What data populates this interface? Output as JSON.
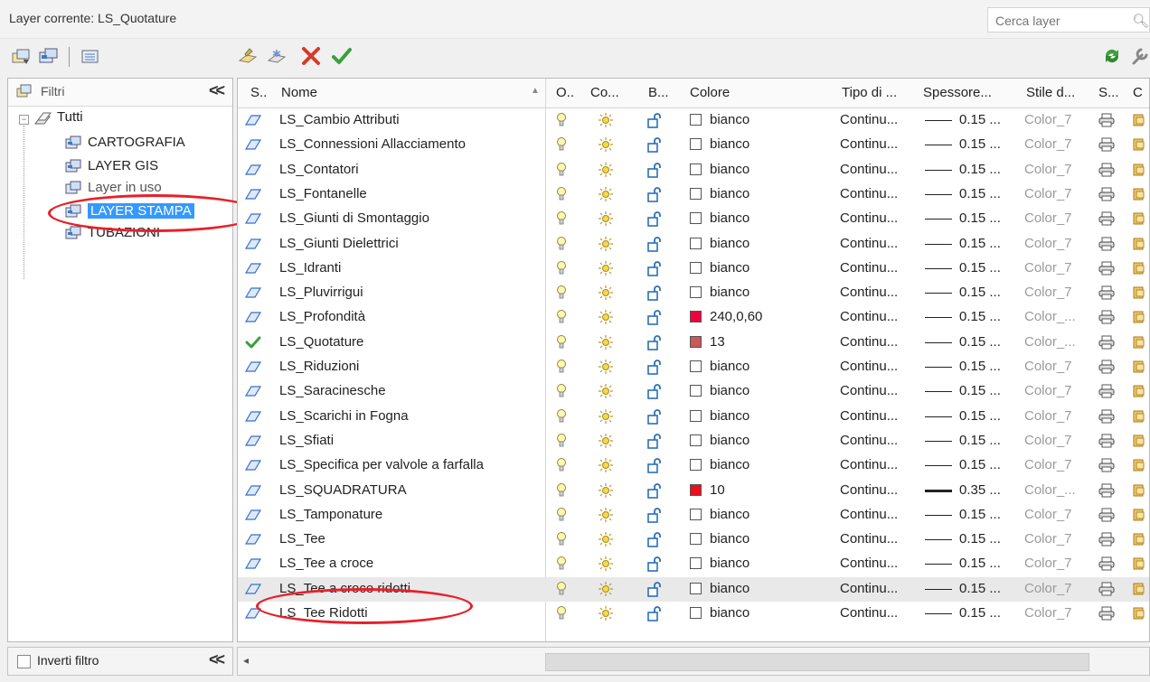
{
  "header": {
    "current_layer": "Layer corrente: LS_Quotature",
    "search_placeholder": "Cerca layer",
    "search_icon": "search-icon"
  },
  "filters": {
    "title": "Filtri",
    "collapse_label": "<<",
    "tree": {
      "root": "Tutti",
      "children": [
        "CARTOGRAFIA",
        "LAYER GIS",
        "Layer in uso",
        "LAYER STAMPA",
        "TUBAZIONI"
      ],
      "selected": "LAYER STAMPA"
    },
    "invert_label": "Inverti filtro",
    "invert_collapse_label": "<<"
  },
  "columns": [
    "S..",
    "Nome",
    "O..",
    "Co...",
    "B...",
    "Colore",
    "Tipo di ...",
    "Spessore...",
    "Stile d...",
    "S...",
    "C"
  ],
  "layers": [
    {
      "name": "LS_Cambio Attributi",
      "color": "bianco",
      "swatch": "#ffffff",
      "linetype": "Continu...",
      "weight": "0.15 ...",
      "style": "Color_7",
      "current": false
    },
    {
      "name": "LS_Connessioni Allacciamento",
      "color": "bianco",
      "swatch": "#ffffff",
      "linetype": "Continu...",
      "weight": "0.15 ...",
      "style": "Color_7",
      "current": false
    },
    {
      "name": "LS_Contatori",
      "color": "bianco",
      "swatch": "#ffffff",
      "linetype": "Continu...",
      "weight": "0.15 ...",
      "style": "Color_7",
      "current": false
    },
    {
      "name": "LS_Fontanelle",
      "color": "bianco",
      "swatch": "#ffffff",
      "linetype": "Continu...",
      "weight": "0.15 ...",
      "style": "Color_7",
      "current": false
    },
    {
      "name": "LS_Giunti di Smontaggio",
      "color": "bianco",
      "swatch": "#ffffff",
      "linetype": "Continu...",
      "weight": "0.15 ...",
      "style": "Color_7",
      "current": false
    },
    {
      "name": "LS_Giunti Dielettrici",
      "color": "bianco",
      "swatch": "#ffffff",
      "linetype": "Continu...",
      "weight": "0.15 ...",
      "style": "Color_7",
      "current": false
    },
    {
      "name": "LS_Idranti",
      "color": "bianco",
      "swatch": "#ffffff",
      "linetype": "Continu...",
      "weight": "0.15 ...",
      "style": "Color_7",
      "current": false
    },
    {
      "name": "LS_Pluvirrigui",
      "color": "bianco",
      "swatch": "#ffffff",
      "linetype": "Continu...",
      "weight": "0.15 ...",
      "style": "Color_7",
      "current": false
    },
    {
      "name": "LS_Profondità",
      "color": "240,0,60",
      "swatch": "#f0003c",
      "linetype": "Continu...",
      "weight": "0.15 ...",
      "style": "Color_...",
      "current": false
    },
    {
      "name": "LS_Quotature",
      "color": "13",
      "swatch": "#c85a5a",
      "linetype": "Continu...",
      "weight": "0.15 ...",
      "style": "Color_...",
      "current": true
    },
    {
      "name": "LS_Riduzioni",
      "color": "bianco",
      "swatch": "#ffffff",
      "linetype": "Continu...",
      "weight": "0.15 ...",
      "style": "Color_7",
      "current": false
    },
    {
      "name": "LS_Saracinesche",
      "color": "bianco",
      "swatch": "#ffffff",
      "linetype": "Continu...",
      "weight": "0.15 ...",
      "style": "Color_7",
      "current": false
    },
    {
      "name": "LS_Scarichi in Fogna",
      "color": "bianco",
      "swatch": "#ffffff",
      "linetype": "Continu...",
      "weight": "0.15 ...",
      "style": "Color_7",
      "current": false
    },
    {
      "name": "LS_Sfiati",
      "color": "bianco",
      "swatch": "#ffffff",
      "linetype": "Continu...",
      "weight": "0.15 ...",
      "style": "Color_7",
      "current": false
    },
    {
      "name": "LS_Specifica per valvole a farfalla",
      "color": "bianco",
      "swatch": "#ffffff",
      "linetype": "Continu...",
      "weight": "0.15 ...",
      "style": "Color_7",
      "current": false
    },
    {
      "name": "LS_SQUADRATURA",
      "color": "10",
      "swatch": "#e8101e",
      "linetype": "Continu...",
      "weight": "0.35 ...",
      "style": "Color_...",
      "current": false,
      "thick": true
    },
    {
      "name": "LS_Tamponature",
      "color": "bianco",
      "swatch": "#ffffff",
      "linetype": "Continu...",
      "weight": "0.15 ...",
      "style": "Color_7",
      "current": false
    },
    {
      "name": "LS_Tee",
      "color": "bianco",
      "swatch": "#ffffff",
      "linetype": "Continu...",
      "weight": "0.15 ...",
      "style": "Color_7",
      "current": false
    },
    {
      "name": "LS_Tee a croce",
      "color": "bianco",
      "swatch": "#ffffff",
      "linetype": "Continu...",
      "weight": "0.15 ...",
      "style": "Color_7",
      "current": false
    },
    {
      "name": "LS_Tee a croce ridotti",
      "color": "bianco",
      "swatch": "#ffffff",
      "linetype": "Continu...",
      "weight": "0.15 ...",
      "style": "Color_7",
      "current": false,
      "highlight": true
    },
    {
      "name": "LS_Tee Ridotti",
      "color": "bianco",
      "swatch": "#ffffff",
      "linetype": "Continu...",
      "weight": "0.15 ...",
      "style": "Color_7",
      "current": false
    }
  ],
  "colors": {
    "selection": "#3399ff",
    "annotation": "#e8202a",
    "check": "#3aa03a",
    "delete": "#d83a2a"
  }
}
